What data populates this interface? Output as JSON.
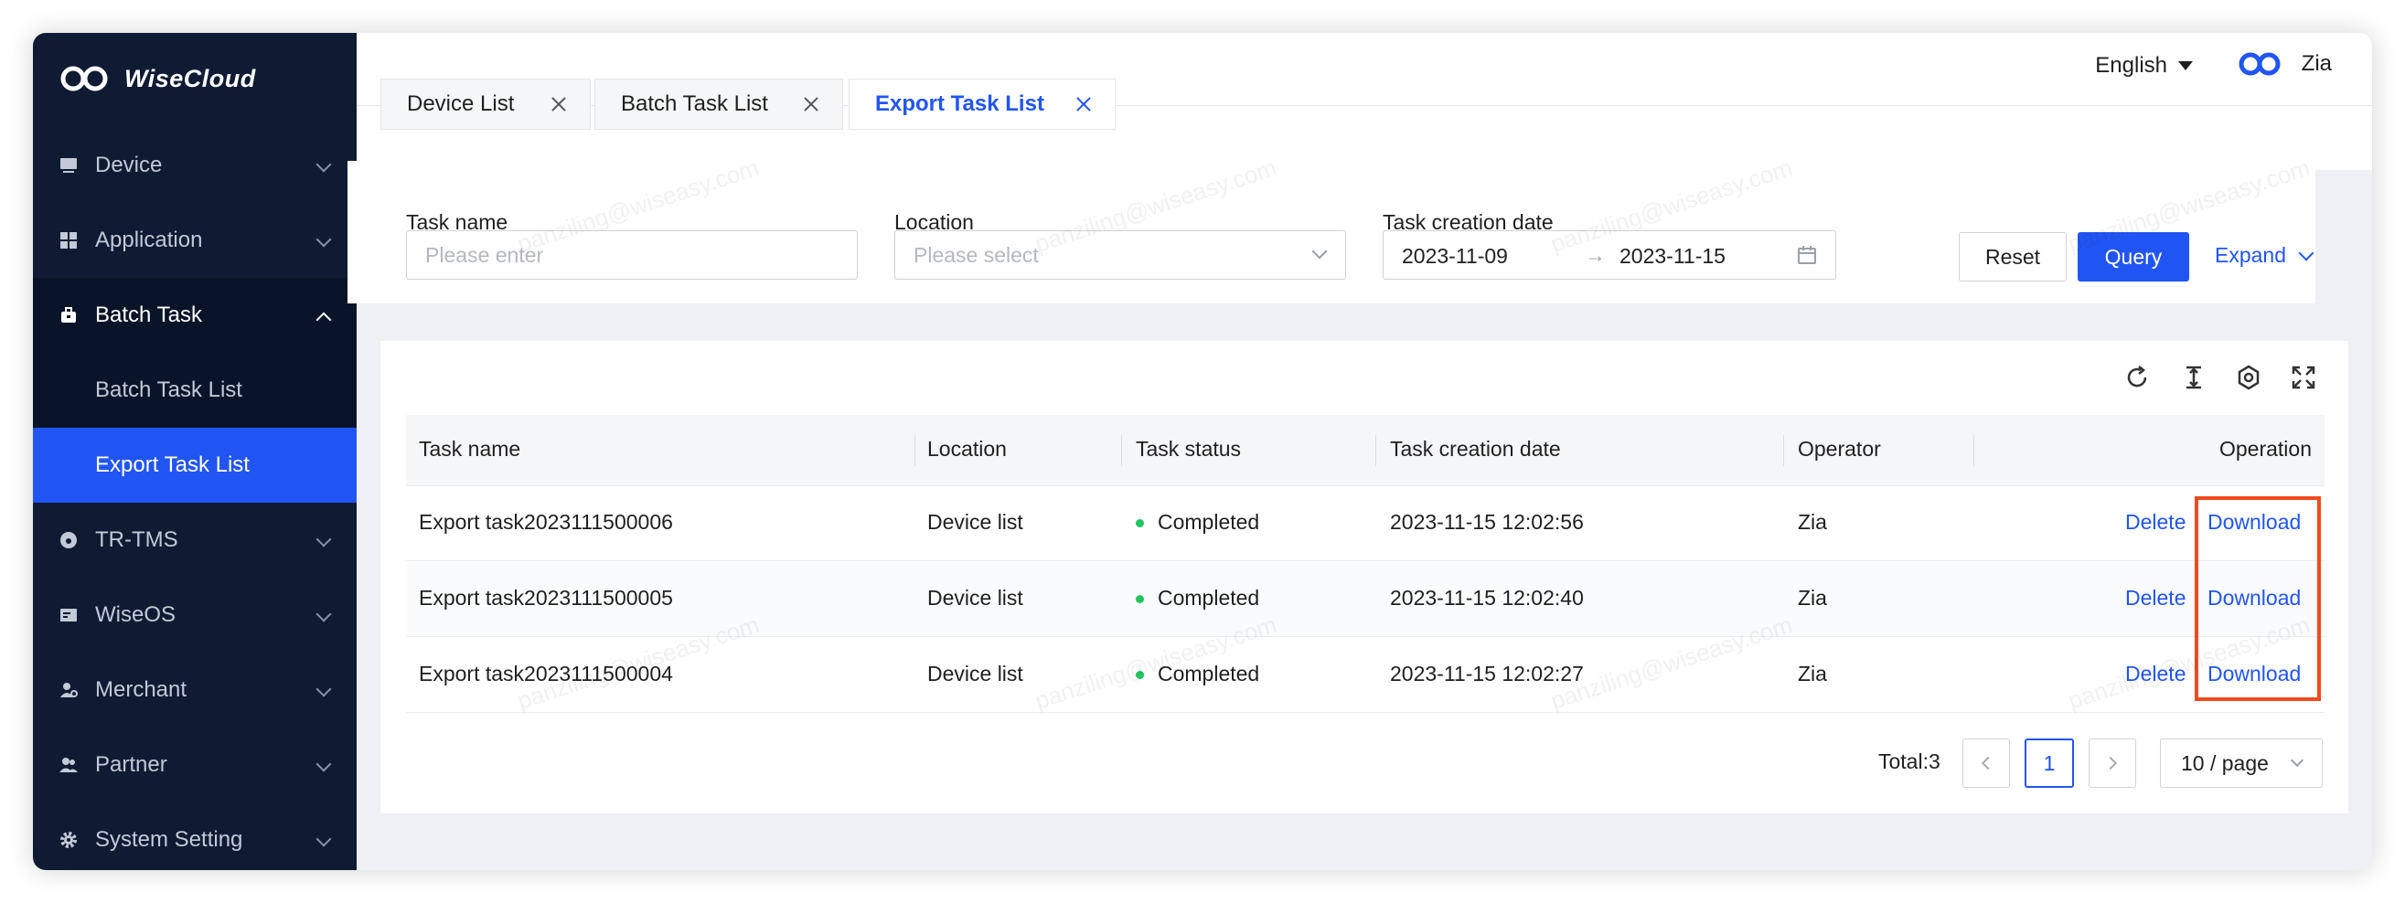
{
  "app": {
    "brand": "WiseCloud"
  },
  "sidebar": {
    "items": [
      {
        "label": "Device",
        "icon": "device-icon"
      },
      {
        "label": "Application",
        "icon": "application-icon"
      },
      {
        "label": "Batch Task",
        "icon": "batch-task-icon",
        "open": true
      },
      {
        "label": "TR-TMS",
        "icon": "tr-tms-icon"
      },
      {
        "label": "WiseOS",
        "icon": "wiseos-icon"
      },
      {
        "label": "Merchant",
        "icon": "merchant-icon"
      },
      {
        "label": "Partner",
        "icon": "partner-icon"
      },
      {
        "label": "System Setting",
        "icon": "gear-icon"
      }
    ],
    "subitems": [
      {
        "label": "Batch Task List"
      },
      {
        "label": "Export Task List",
        "active": true
      }
    ]
  },
  "header": {
    "language": "English",
    "user": "Zia"
  },
  "tabs": [
    {
      "label": "Device List"
    },
    {
      "label": "Batch Task List"
    },
    {
      "label": "Export Task List",
      "active": true
    }
  ],
  "filters": {
    "task_name": {
      "label": "Task name",
      "placeholder": "Please enter"
    },
    "location": {
      "label": "Location",
      "placeholder": "Please select"
    },
    "date": {
      "label": "Task creation date",
      "start": "2023-11-09",
      "end": "2023-11-15",
      "separator": "→"
    },
    "reset_label": "Reset",
    "query_label": "Query",
    "expand_label": "Expand"
  },
  "table": {
    "columns": [
      "Task name",
      "Location",
      "Task status",
      "Task creation date",
      "Operator",
      "Operation"
    ],
    "rows": [
      {
        "name": "Export task2023111500006",
        "location": "Device list",
        "status": "Completed",
        "date": "2023-11-15 12:02:56",
        "operator": "Zia",
        "delete": "Delete",
        "download": "Download"
      },
      {
        "name": "Export task2023111500005",
        "location": "Device list",
        "status": "Completed",
        "date": "2023-11-15 12:02:40",
        "operator": "Zia",
        "delete": "Delete",
        "download": "Download"
      },
      {
        "name": "Export task2023111500004",
        "location": "Device list",
        "status": "Completed",
        "date": "2023-11-15 12:02:27",
        "operator": "Zia",
        "delete": "Delete",
        "download": "Download"
      }
    ],
    "status_color": "#22c55e"
  },
  "pagination": {
    "total": "Total:3",
    "current": "1",
    "page_size": "10 / page"
  },
  "watermark": "panziling@wiseasy.com",
  "colors": {
    "accent": "#2155f3",
    "sidebar_bg": "#0f1b33",
    "highlight": "#f04a1f"
  }
}
